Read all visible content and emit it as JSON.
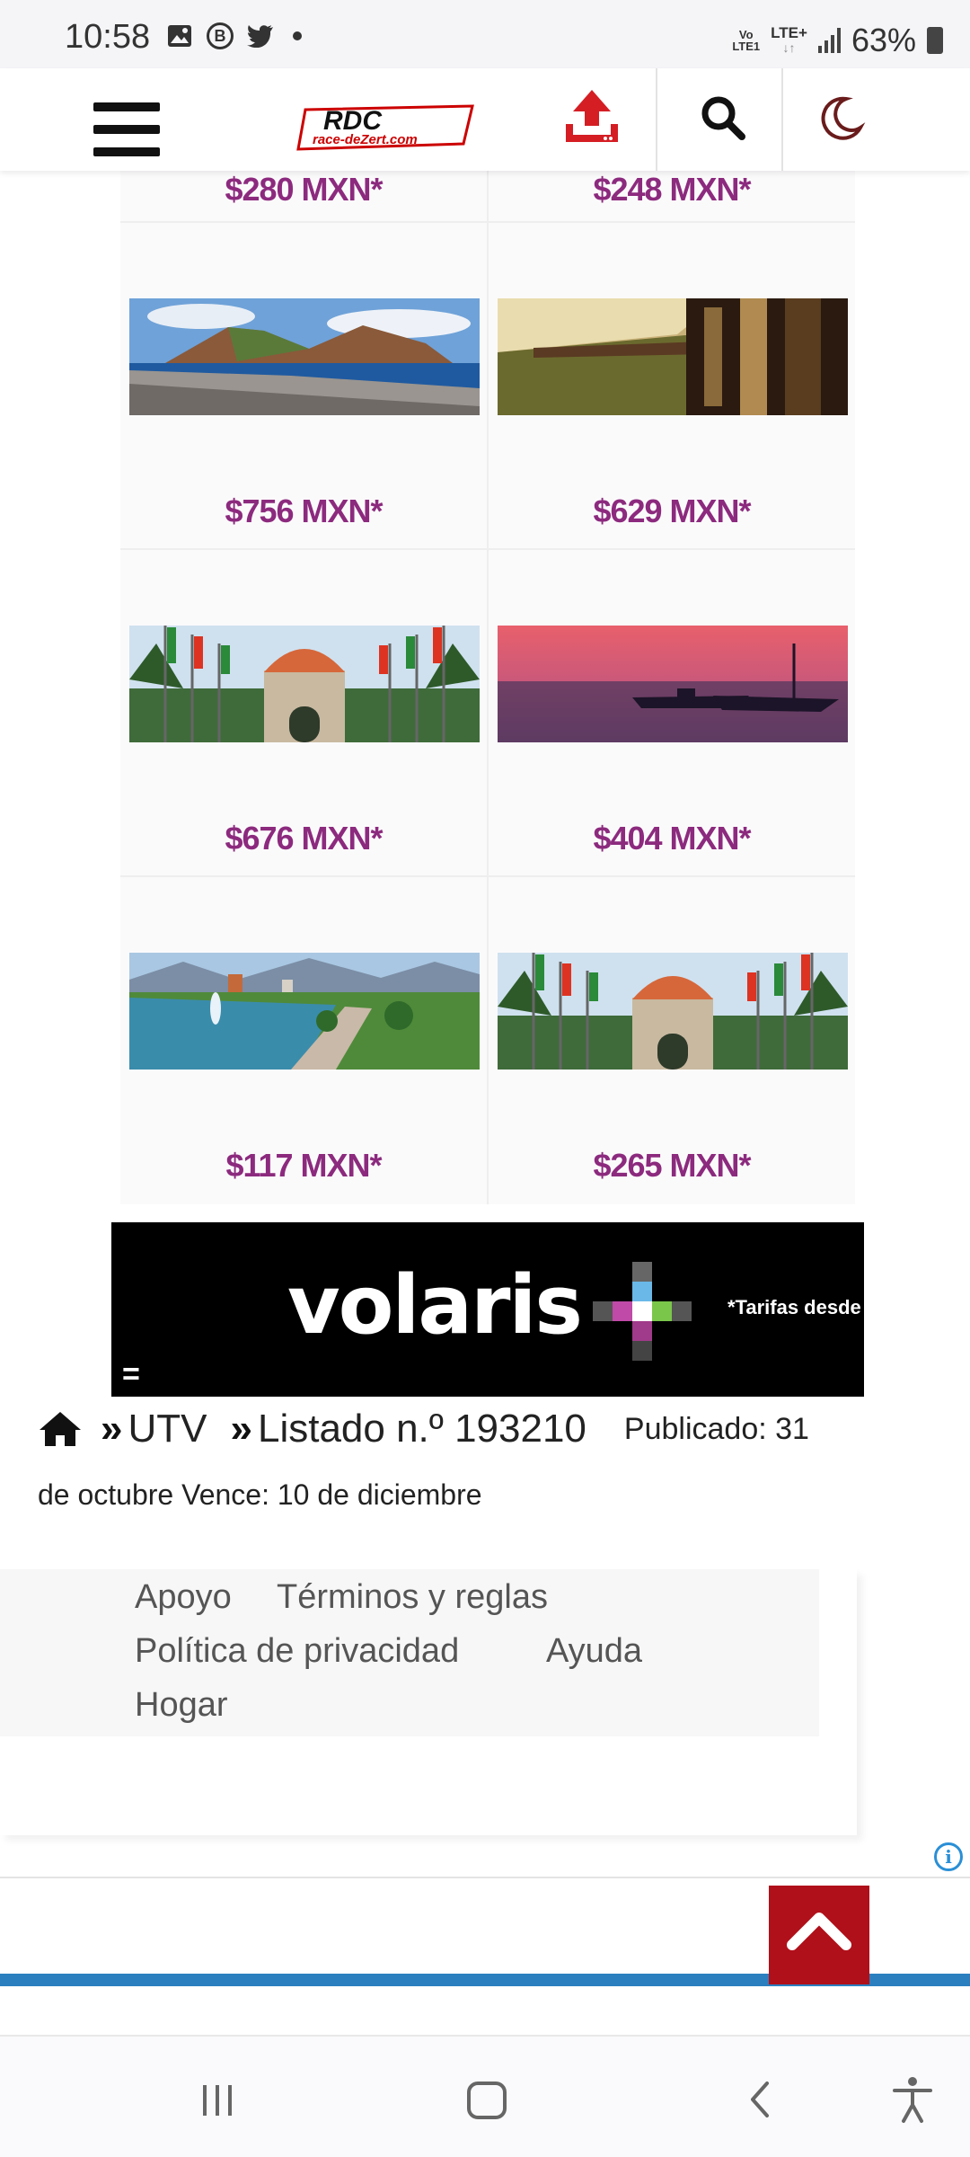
{
  "status_bar": {
    "time": "10:58",
    "network_top": "Vo",
    "network_bottom": "LTE1",
    "lte_label": "LTE+",
    "battery": "63%"
  },
  "header": {
    "logo_top": "RDC",
    "logo_bottom": "race-deZert.com"
  },
  "flights": [
    {
      "price": "$280 MXN*",
      "image": "partial"
    },
    {
      "price": "$248 MXN*",
      "image": "partial"
    },
    {
      "price": "$756 MXN*",
      "image": "coast-mountain"
    },
    {
      "price": "$629 MXN*",
      "image": "train-canyon"
    },
    {
      "price": "$676 MXN*",
      "image": "monument-flags"
    },
    {
      "price": "$404 MXN*",
      "image": "sunset-boats"
    },
    {
      "price": "$117 MXN*",
      "image": "park-lake"
    },
    {
      "price": "$265 MXN*",
      "image": "monument-flags"
    }
  ],
  "ad": {
    "brand": "volaris",
    "tagline": "*Tarifas desde",
    "icon": "equals-icon"
  },
  "breadcrumb": {
    "category": "UTV",
    "listing": "Listado n.º 193210",
    "published_part1": "Publicado: 31",
    "published_part2": "de octubre Vence: 10 de diciembre"
  },
  "footer": {
    "links": {
      "support": "Apoyo",
      "terms": "Términos y reglas",
      "privacy": "Política de privacidad",
      "help": "Ayuda",
      "home": "Hogar"
    }
  },
  "colors": {
    "price": "#8c2a7e",
    "accent_red": "#b0101a",
    "info_blue": "#2a8fd6"
  }
}
